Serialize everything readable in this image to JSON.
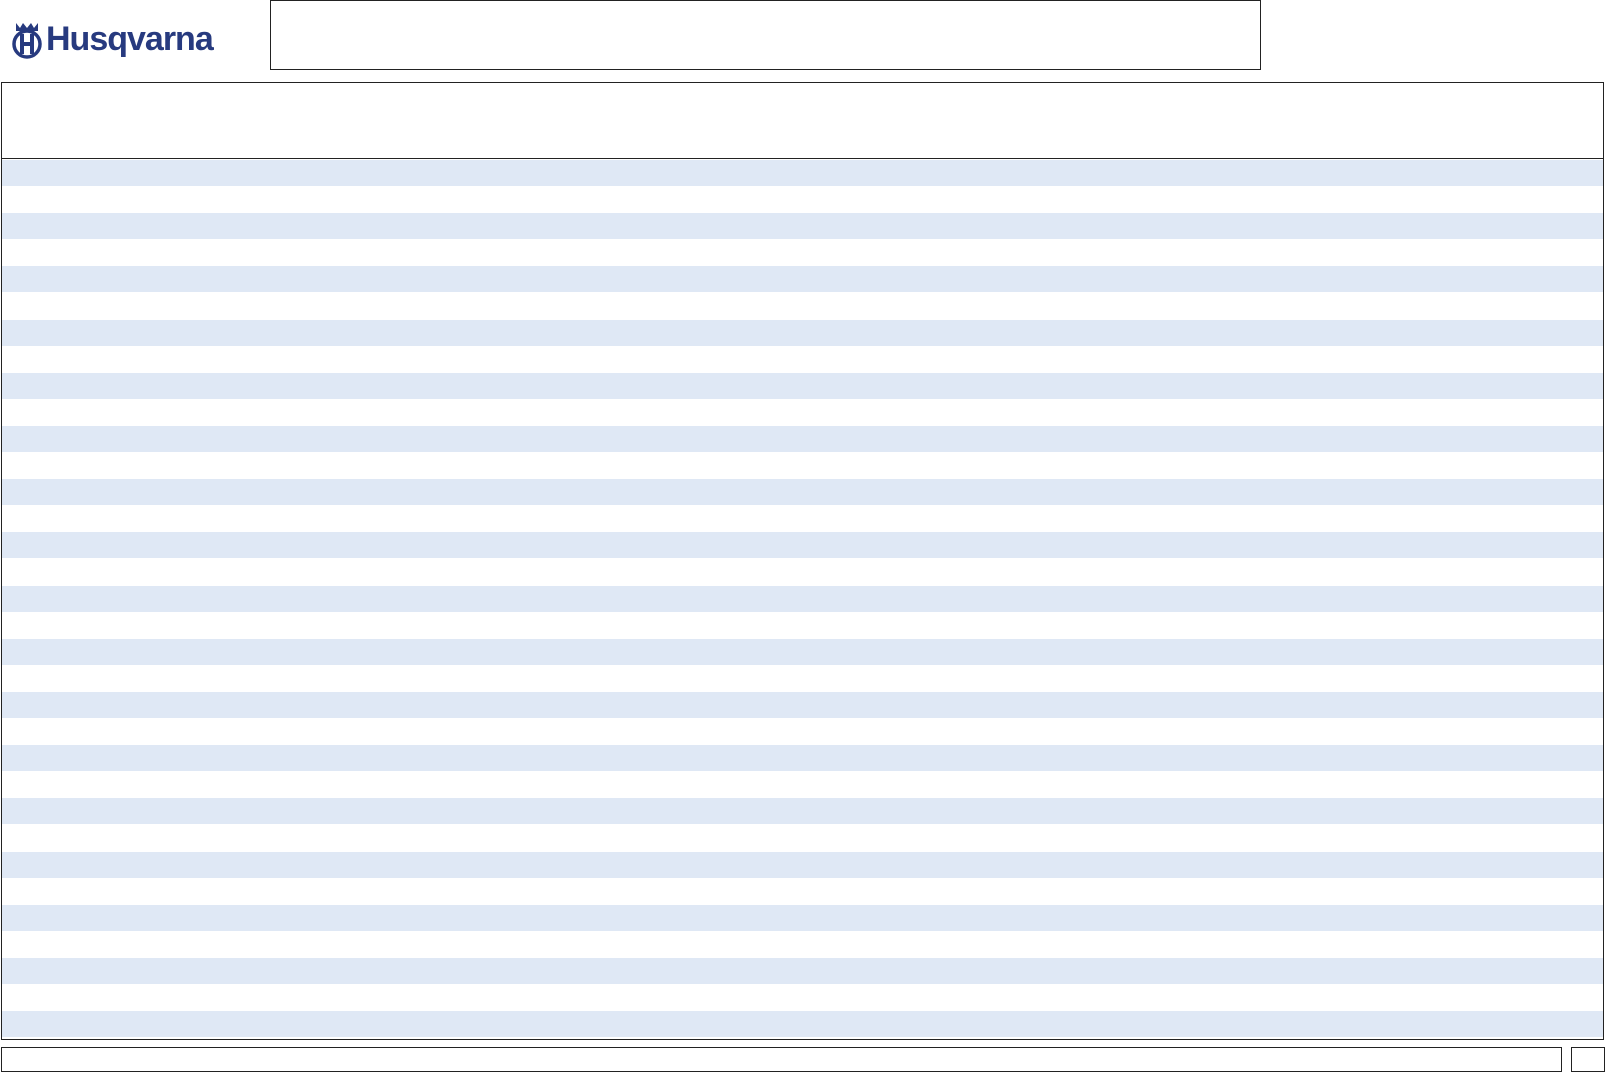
{
  "brand": {
    "name": "Husqvarna",
    "color": "#273a7f",
    "logo_icon": "husqvarna-crown-h-icon"
  },
  "form": {
    "title": "",
    "header_text": "",
    "row_count": 33,
    "stripe_color": "#dfe8f5"
  },
  "footer": {
    "text": "",
    "page_number": ""
  }
}
